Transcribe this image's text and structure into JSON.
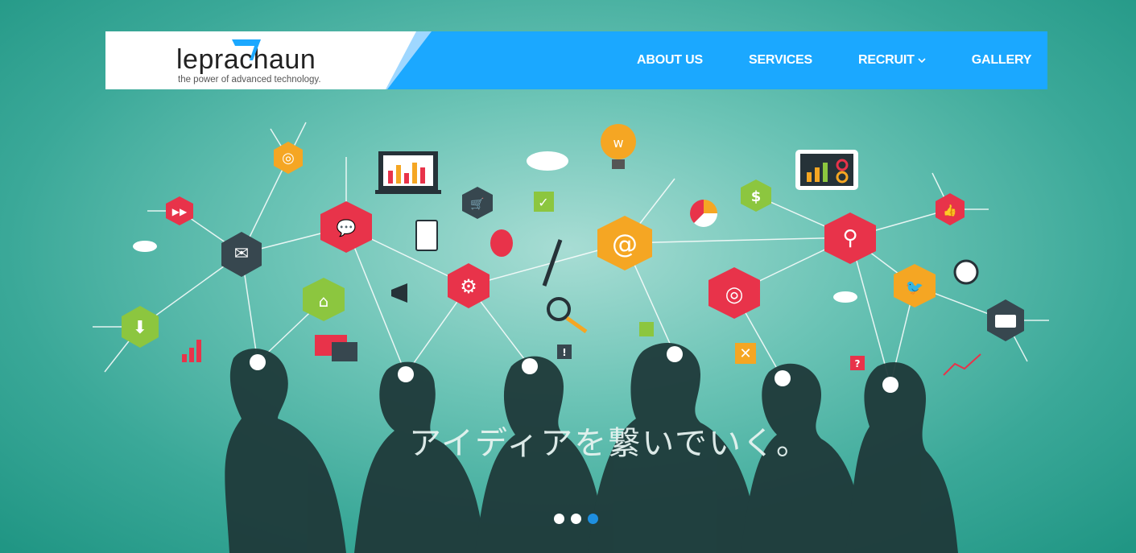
{
  "brand": {
    "name": "leprachaun",
    "tagline": "the power of advanced technology."
  },
  "nav": {
    "items": [
      {
        "label": "ABOUT US"
      },
      {
        "label": "SERVICES"
      },
      {
        "label": "RECRUIT"
      },
      {
        "label": "GALLERY"
      }
    ]
  },
  "hero": {
    "headline": "アイディアを繋いでいく。"
  },
  "slider": {
    "total": 3,
    "active_index": 3
  },
  "colors": {
    "nav_bg": "#1ba8ff",
    "accent_stripe": "#9fd7ff",
    "active_dot": "#1e8fe0",
    "background": "#3aa898"
  },
  "icons": [
    "logo-mark-icon",
    "chevron-down-icon",
    "globe-icon",
    "mail-icon",
    "download-icon",
    "home-icon",
    "gear-icon",
    "at-icon",
    "search-icon",
    "target-icon",
    "twitter-icon",
    "card-icon",
    "dollar-icon",
    "lightbulb-icon",
    "cart-icon",
    "chat-icon",
    "thumbs-up-icon",
    "clock-icon",
    "balloon-icon",
    "pen-icon",
    "magnifier-icon",
    "megaphone-icon",
    "cloud-icon",
    "chart-icon",
    "pie-chart-icon",
    "fast-forward-icon"
  ]
}
